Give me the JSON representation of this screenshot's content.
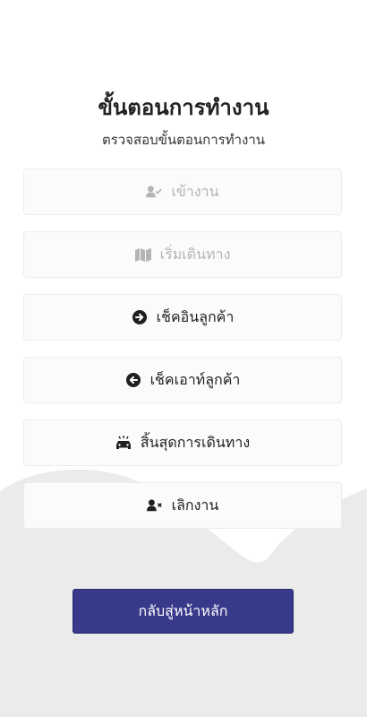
{
  "page": {
    "title": "ขั้นตอนการทำงาน",
    "subtitle": "ตรวจสอบขั้นตอนการทำงาน"
  },
  "steps": [
    {
      "label": "เข้างาน",
      "icon": "user-check-icon",
      "enabled": false
    },
    {
      "label": "เริ่มเดินทาง",
      "icon": "map-icon",
      "enabled": false
    },
    {
      "label": "เช็คอินลูกค้า",
      "icon": "arrow-circle-right-icon",
      "enabled": true
    },
    {
      "label": "เช็คเอาท์ลูกค้า",
      "icon": "arrow-circle-left-icon",
      "enabled": true
    },
    {
      "label": "สิ้นสุดการเดินทาง",
      "icon": "car-icon",
      "enabled": true
    },
    {
      "label": "เลิกงาน",
      "icon": "user-times-icon",
      "enabled": true
    }
  ],
  "home_button": {
    "label": "กลับสู่หน้าหลัก"
  },
  "colors": {
    "primary": "#37398a",
    "disabled_text": "#b4b4b4",
    "card_bg": "#fbfbfb",
    "wave_bg": "#ebebeb"
  }
}
